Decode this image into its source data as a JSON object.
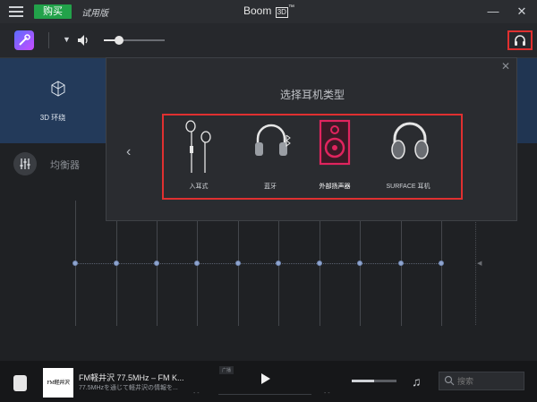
{
  "titlebar": {
    "buy_label": "购买",
    "trial_label": "试用版",
    "app_name": "Boom",
    "app_badge": "3D",
    "app_tm": "™",
    "minimize": "—",
    "close": "✕"
  },
  "toolbar": {
    "volume_level": 0.25
  },
  "left_panel": {
    "surround_label": "3D 环绕"
  },
  "equalizer": {
    "label": "均衡器",
    "band_levels": [
      0,
      0,
      0,
      0,
      0,
      0,
      0,
      0,
      0,
      0
    ]
  },
  "popup": {
    "title": "选择耳机类型",
    "close": "✕",
    "prev": "‹",
    "options": [
      {
        "label": "入耳式",
        "icon": "earbuds-icon",
        "selected": false
      },
      {
        "label": "蓝牙",
        "icon": "bluetooth-headphones-icon",
        "selected": false
      },
      {
        "label": "外部扬声器",
        "icon": "speaker-icon",
        "selected": true
      },
      {
        "label": "SURFACE 耳机",
        "icon": "surface-headphones-icon",
        "selected": false
      }
    ]
  },
  "player": {
    "cover_text": "FM軽井沢",
    "station": "FM軽井沢 77.5MHz – FM K...",
    "station_sub": "77.5MHzを通じて軽井沢の情報を...",
    "stream_badge": "广播",
    "time_left": "- -",
    "time_right": "- -",
    "volume_level": 0.5,
    "search_placeholder": "搜索"
  },
  "colors": {
    "accent_red": "#e03030",
    "buy_green": "#22a24a",
    "selected_pink": "#e0245e",
    "panel_blue": "#233a5a"
  }
}
